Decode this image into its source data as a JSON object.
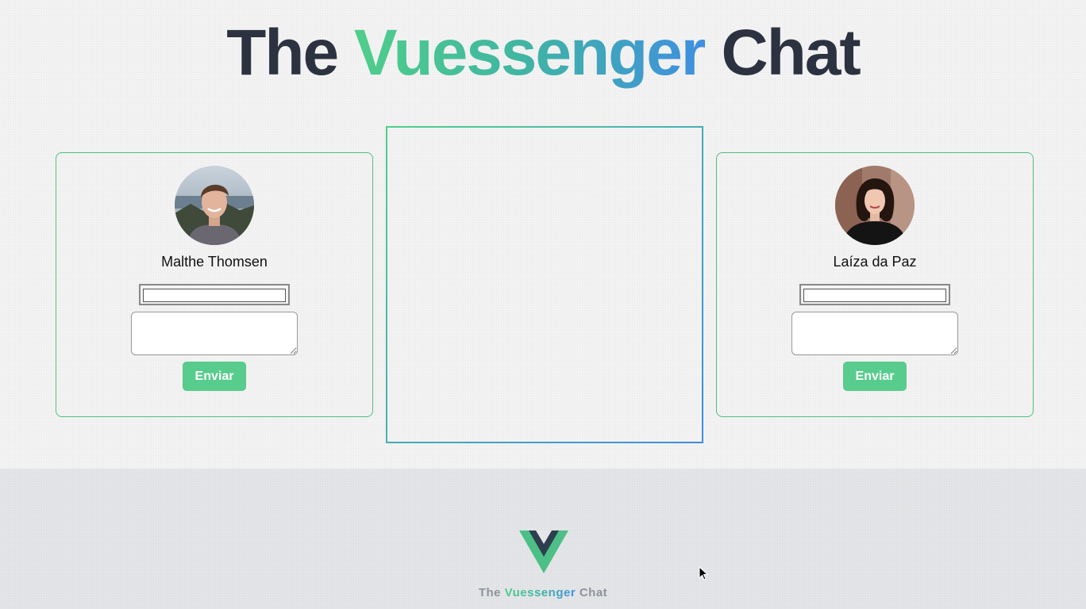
{
  "header": {
    "title_pre": "The ",
    "title_brand": "Vuessenger",
    "title_post": " Chat"
  },
  "users": [
    {
      "name": "Malthe Thomsen",
      "send_label": "Enviar",
      "message_value": "",
      "text_value": ""
    },
    {
      "name": "Laíza da Paz",
      "send_label": "Enviar",
      "message_value": "",
      "text_value": ""
    }
  ],
  "chat": {
    "messages": []
  },
  "footer": {
    "title_pre": "The ",
    "title_brand": "Vuessenger",
    "title_post": " Chat",
    "logo_icon": "vue-logo-icon"
  },
  "colors": {
    "accent_green": "#57cc8c",
    "accent_blue": "#3f8fe0",
    "text_dark": "#2c3240",
    "footer_bg": "#e5e6e9"
  }
}
